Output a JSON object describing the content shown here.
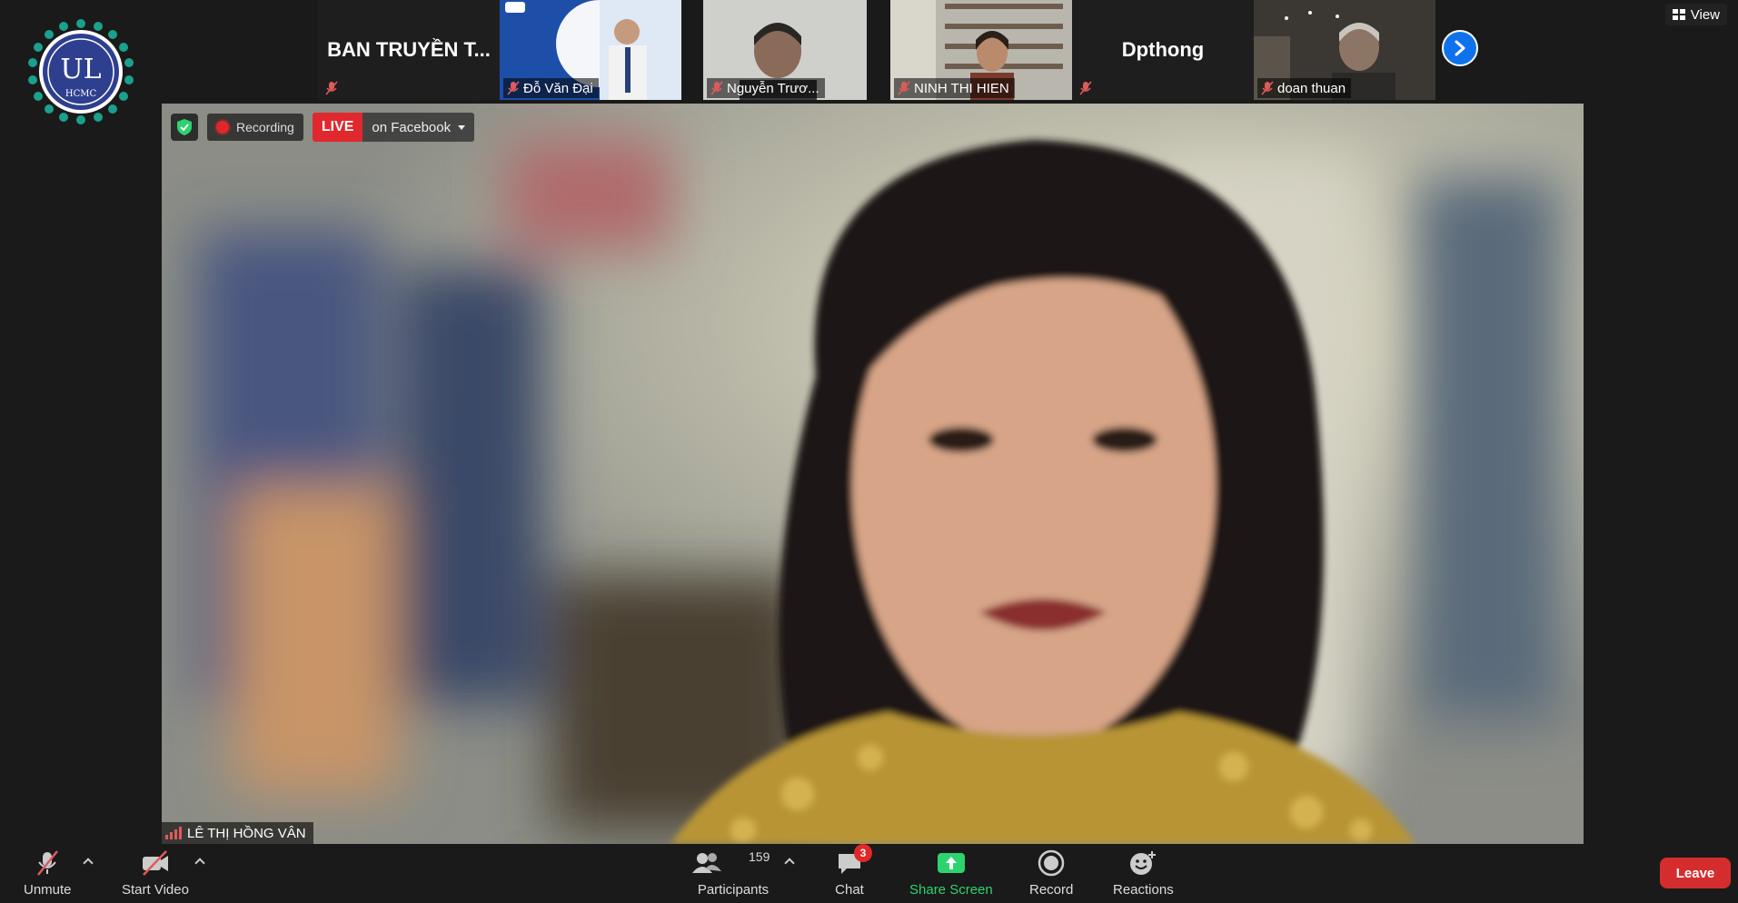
{
  "logo": {
    "text": "UL",
    "subtext": "HCMC"
  },
  "view_button": {
    "label": "View"
  },
  "filmstrip": [
    {
      "name": "BAN TRUYỀN T...",
      "type": "name-only"
    },
    {
      "name": "Đỗ Văn Đại",
      "type": "video"
    },
    {
      "name": "Nguyễn Trươ...",
      "type": "video"
    },
    {
      "name": "NINH THI HIEN",
      "type": "video"
    },
    {
      "name": "Dpthong",
      "type": "name-only"
    },
    {
      "name": "doan thuan",
      "type": "video"
    }
  ],
  "main_video": {
    "recording_label": "Recording",
    "live_tag": "LIVE",
    "live_destination": "on Facebook",
    "speaker_name": "LÊ THỊ HỒNG VÂN"
  },
  "toolbar": {
    "unmute": "Unmute",
    "start_video": "Start Video",
    "participants": "Participants",
    "participants_count": "159",
    "chat": "Chat",
    "chat_unread": "3",
    "share_screen": "Share Screen",
    "record": "Record",
    "reactions": "Reactions",
    "leave": "Leave"
  },
  "colors": {
    "background": "#1a1a1a",
    "accent_blue": "#0e72ed",
    "live_red": "#e0282e",
    "share_green": "#2dd36f",
    "leave_red": "#d52d2d"
  }
}
